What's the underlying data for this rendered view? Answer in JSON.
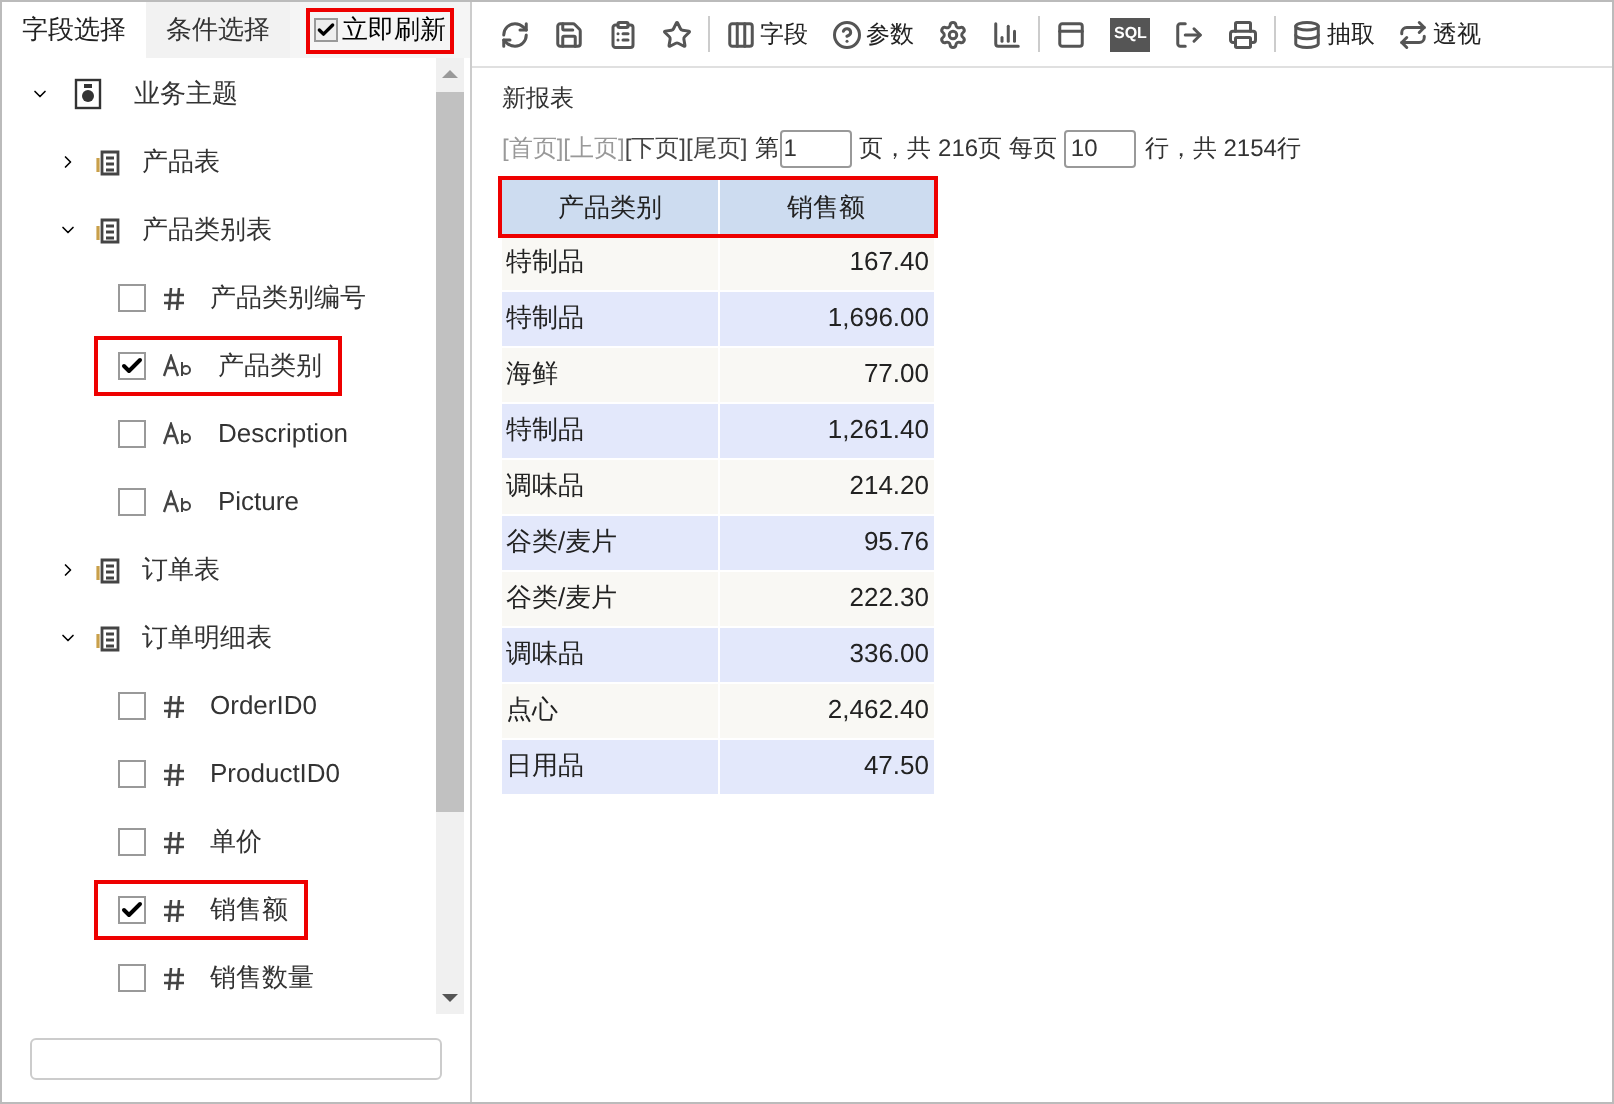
{
  "left_tabs": [
    {
      "label": "字段选择",
      "selected": true
    },
    {
      "label": "条件选择",
      "selected": false
    }
  ],
  "auto_refresh": {
    "label": "立即刷新",
    "checked": true,
    "highlighted": true
  },
  "tree": {
    "label": "业务主题",
    "expanded": true,
    "children": [
      {
        "label": "产品表",
        "expanded": false
      },
      {
        "label": "产品类别表",
        "expanded": true,
        "children": [
          {
            "label": "产品类别编号",
            "kind": "number",
            "checked": false,
            "highlighted": false
          },
          {
            "label": "产品类别",
            "kind": "text",
            "checked": true,
            "highlighted": true
          },
          {
            "label": "Description",
            "kind": "text",
            "checked": false,
            "highlighted": false
          },
          {
            "label": "Picture",
            "kind": "text",
            "checked": false,
            "highlighted": false
          }
        ]
      },
      {
        "label": "订单表",
        "expanded": false
      },
      {
        "label": "订单明细表",
        "expanded": true,
        "children": [
          {
            "label": "OrderID0",
            "kind": "number",
            "checked": false,
            "highlighted": false
          },
          {
            "label": "ProductID0",
            "kind": "number",
            "checked": false,
            "highlighted": false
          },
          {
            "label": "单价",
            "kind": "number",
            "checked": false,
            "highlighted": false
          },
          {
            "label": "销售额",
            "kind": "number",
            "checked": true,
            "highlighted": true
          },
          {
            "label": "销售数量",
            "kind": "number",
            "checked": false,
            "highlighted": false
          }
        ]
      }
    ]
  },
  "toolbar": [
    {
      "kind": "icon"
    },
    {
      "kind": "icon"
    },
    {
      "kind": "icon"
    },
    {
      "kind": "icon"
    },
    {
      "kind": "labeled",
      "label": "字段"
    },
    {
      "kind": "labeled",
      "label": "参数"
    },
    {
      "kind": "icon"
    },
    {
      "kind": "icon"
    },
    {
      "kind": "icon"
    },
    {
      "kind": "badge",
      "label": "SQL"
    },
    {
      "kind": "icon"
    },
    {
      "kind": "icon"
    },
    {
      "kind": "labeled",
      "label": "抽取"
    },
    {
      "kind": "labeled",
      "label": "透视"
    }
  ],
  "report_title": "新报表",
  "pager": {
    "links": [
      {
        "label": "[首页]",
        "disabled": true
      },
      {
        "label": "[上页]",
        "disabled": true
      },
      {
        "label": "[下页]",
        "disabled": false
      },
      {
        "label": "[尾页]",
        "disabled": false
      }
    ],
    "page_prefix": "第",
    "page": "1",
    "page_suffix": "页，共 216页 每页",
    "per_page": "10",
    "rows_suffix": "行，共 2154行"
  },
  "table": {
    "highlighted": true,
    "columns": [
      "产品类别",
      "销售额"
    ],
    "rows": [
      [
        "特制品",
        "167.40"
      ],
      [
        "特制品",
        "1,696.00"
      ],
      [
        "海鲜",
        "77.00"
      ],
      [
        "特制品",
        "1,261.40"
      ],
      [
        "调味品",
        "214.20"
      ],
      [
        "谷类/麦片",
        "95.76"
      ],
      [
        "谷类/麦片",
        "222.30"
      ],
      [
        "调味品",
        "336.00"
      ],
      [
        "点心",
        "2,462.40"
      ],
      [
        "日用品",
        "47.50"
      ]
    ]
  }
}
